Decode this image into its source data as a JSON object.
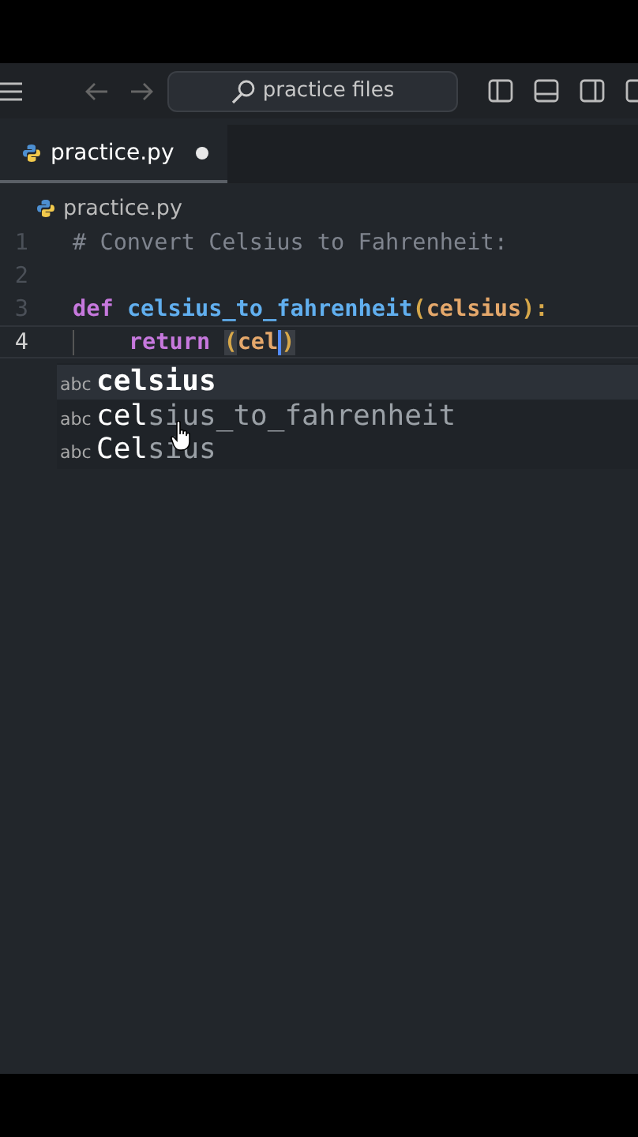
{
  "title_bar": {
    "search": {
      "value": "practice files"
    }
  },
  "tabs": [
    {
      "label": "practice.py",
      "selected": true,
      "modified": true
    }
  ],
  "breadcrumb": "practice.py",
  "lines": [
    {
      "number": "1",
      "current": false,
      "tokens": [
        {
          "kind": "comment",
          "text": "# Convert Celsius to Fahrenheit:"
        }
      ]
    },
    {
      "number": "2",
      "current": false
    },
    {
      "number": "3",
      "current": false,
      "tokens": [
        {
          "kind": "keyword",
          "text": "def "
        },
        {
          "kind": "function",
          "text": "celsius_to_fahrenheit"
        },
        {
          "kind": "bracket",
          "text": "("
        },
        {
          "kind": "param",
          "text": "celsius"
        },
        {
          "kind": "bracket",
          "text": "):"
        }
      ]
    },
    {
      "number": "4",
      "current": true,
      "tokens": [
        {
          "kind": "indent"
        },
        {
          "kind": "keyword",
          "text": "return "
        },
        {
          "kind": "matched",
          "text": "("
        },
        {
          "kind": "param",
          "text": "cel"
        },
        {
          "kind": "cursor"
        },
        {
          "kind": "matched",
          "text": ")"
        }
      ]
    }
  ],
  "suggestions": [
    {
      "type": "abc",
      "label": "celsius",
      "selected": true
    },
    {
      "type": "abc",
      "label": "**cel**sius_to_fahrenheit",
      "selected": false
    },
    {
      "type": "abc",
      "label": "**Cel**sius",
      "selected": false
    }
  ]
}
